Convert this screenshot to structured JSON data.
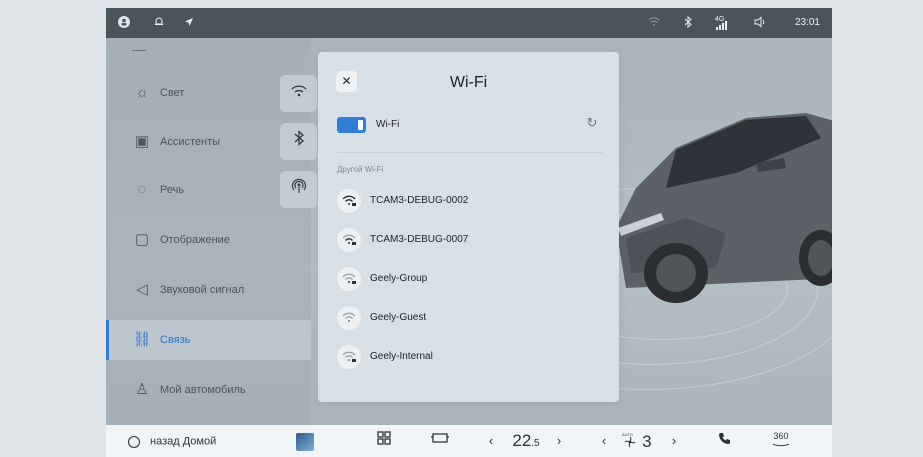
{
  "status_bar": {
    "signal_text": "4G",
    "time": "23:01"
  },
  "sidebar": {
    "items": [
      {
        "label": "Свет",
        "icon": "light-bulb-icon"
      },
      {
        "label": "Ассистенты",
        "icon": "assistant-icon"
      },
      {
        "label": "Речь",
        "icon": "speech-icon"
      },
      {
        "label": "Отображение",
        "icon": "display-icon"
      },
      {
        "label": "Звуковой сигнал",
        "icon": "speaker-icon"
      },
      {
        "label": "Связь",
        "icon": "link-icon",
        "active": true
      },
      {
        "label": "Мой автомобиль",
        "icon": "person-icon"
      }
    ]
  },
  "wifi_dialog": {
    "title": "Wi-Fi",
    "toggle_label": "Wi-Fi",
    "toggle_on": true,
    "section_label": "Другой Wi-Fi",
    "networks": [
      "TCAM3-DEBUG-0002",
      "TCAM3-DEBUG-0007",
      "Geely-Group",
      "Geely-Guest",
      "Geely-Internal"
    ]
  },
  "dock": {
    "home_label": "назад Домой",
    "temperature_whole": "22",
    "temperature_fraction": ".5",
    "fan_level": "3",
    "fan_sub": "AUTO",
    "view_360": "360"
  },
  "colors": {
    "accent": "#2f7ed8",
    "status_bar": "#4a545b",
    "dialog": "#d7e0e6"
  }
}
